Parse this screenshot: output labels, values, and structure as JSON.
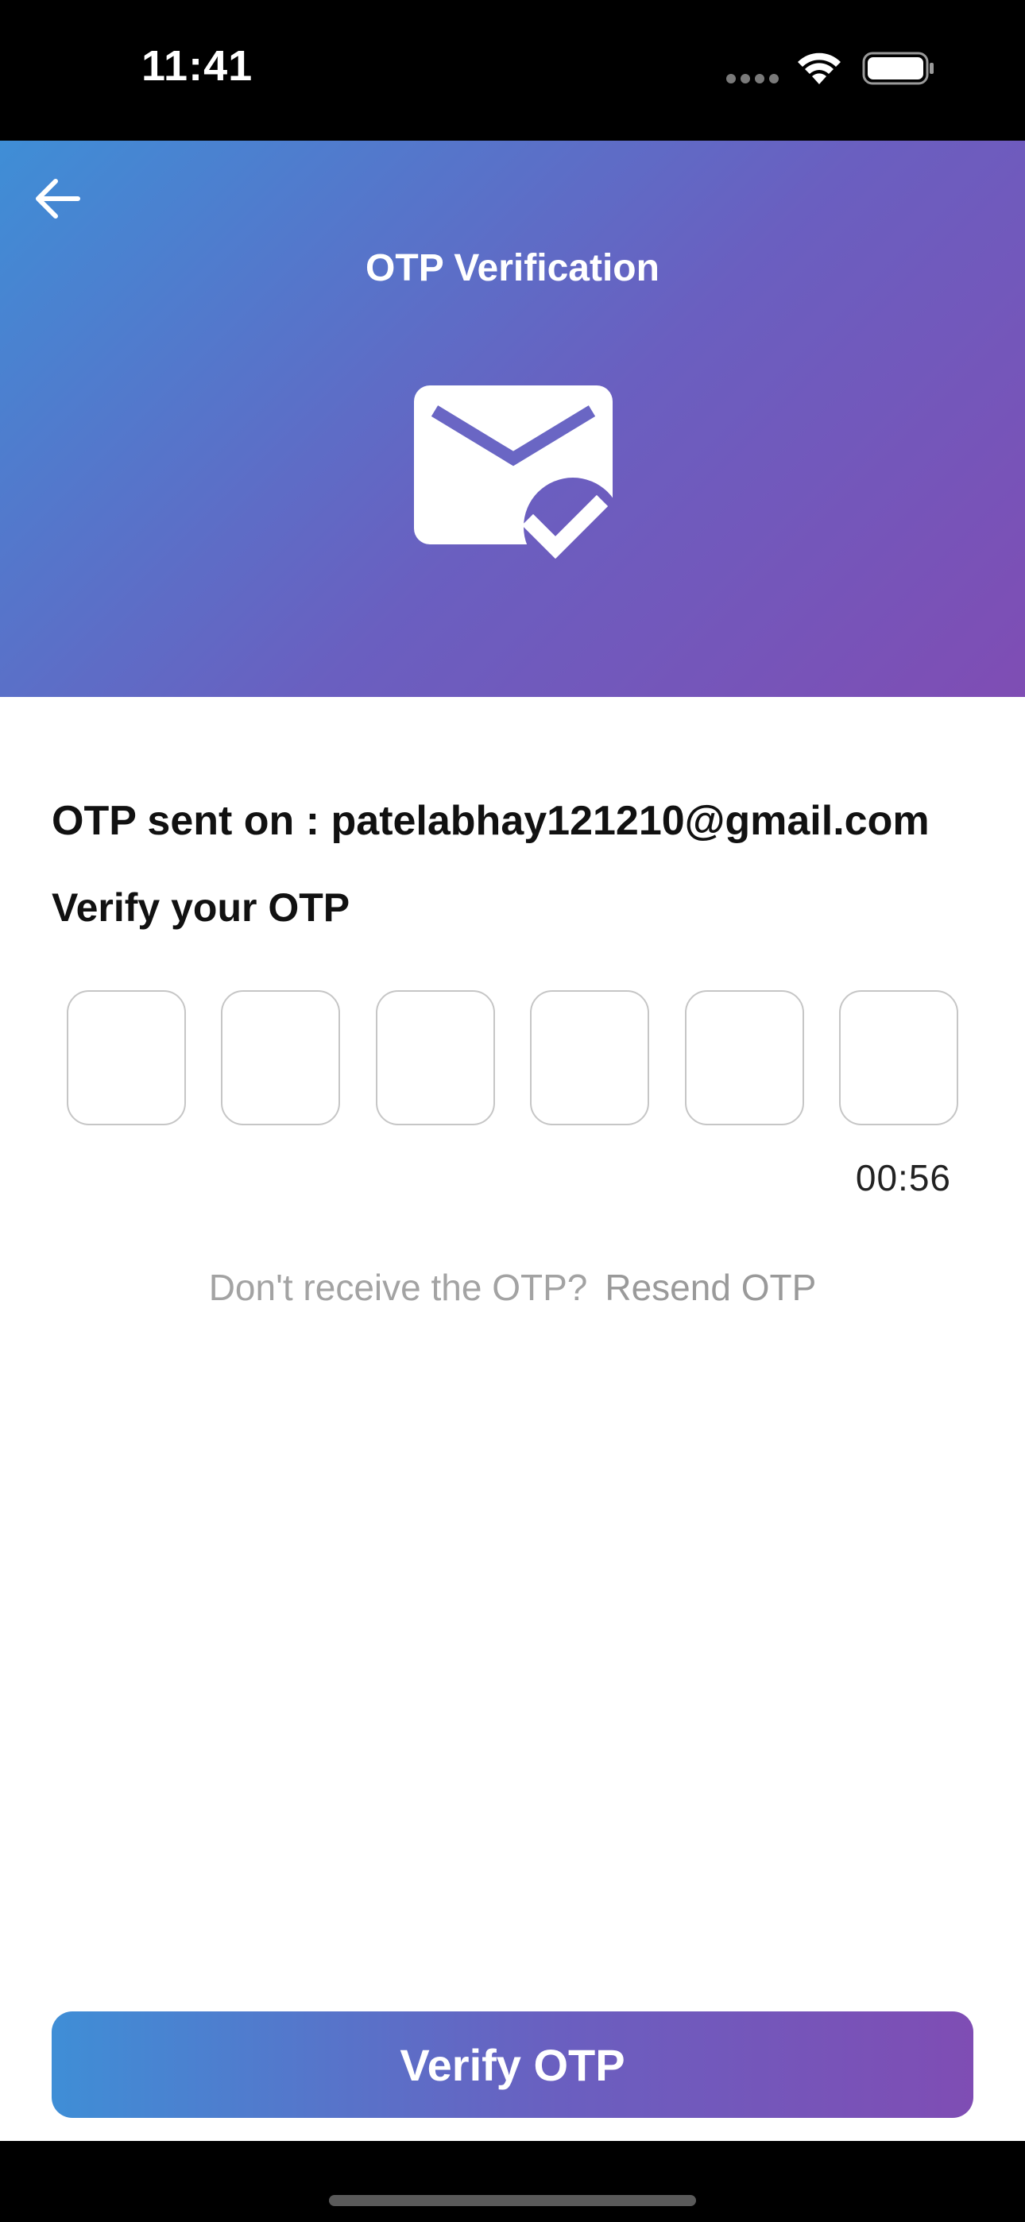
{
  "status_bar": {
    "time": "11:41",
    "icons": [
      "signal-dots-icon",
      "wifi-icon",
      "battery-icon"
    ]
  },
  "header": {
    "back_icon": "arrow-left-icon",
    "title": "OTP Verification",
    "illustration_icon": "mail-check-icon",
    "gradient_colors": [
      "#3f8ed6",
      "#6a5fc0",
      "#7f4db4"
    ]
  },
  "content": {
    "otp_sent_text": "OTP sent on : patelabhay121210@gmail.com",
    "verify_label": "Verify your OTP",
    "otp_digits": [
      "",
      "",
      "",
      "",
      "",
      ""
    ],
    "timer": "00:56",
    "resend_prompt": "Don't receive the OTP?",
    "resend_link": "Resend OTP"
  },
  "footer": {
    "verify_button_label": "Verify OTP"
  }
}
